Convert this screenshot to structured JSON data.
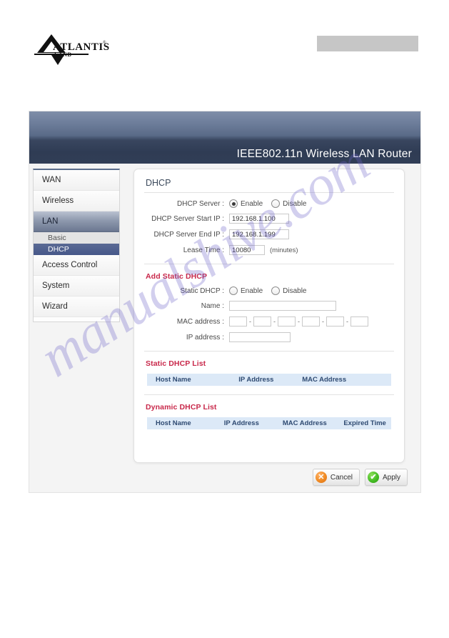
{
  "brand": {
    "logo_text": "ATLANTIS",
    "logo_subtext": "LAND",
    "logo_tm": "®",
    "logo_icon": "atlantis-triangle-logo"
  },
  "watermark": {
    "text": "manualshive.com"
  },
  "banner": {
    "title": "IEEE802.11n  Wireless LAN Router"
  },
  "sidebar": {
    "items": [
      {
        "label": "WAN",
        "type": "main",
        "active": false
      },
      {
        "label": "Wireless",
        "type": "main",
        "active": false
      },
      {
        "label": "LAN",
        "type": "main",
        "active": true
      },
      {
        "label": "Basic",
        "type": "sub",
        "active": false
      },
      {
        "label": "DHCP",
        "type": "sub",
        "active": true
      },
      {
        "label": "Access Control",
        "type": "main",
        "active": false
      },
      {
        "label": "System",
        "type": "main",
        "active": false
      },
      {
        "label": "Wizard",
        "type": "main",
        "active": false
      }
    ]
  },
  "panel": {
    "title": "DHCP",
    "dhcp": {
      "server_label": "DHCP Server :",
      "enable_label": "Enable",
      "disable_label": "Disable",
      "server_selected": "Enable",
      "start_ip_label": "DHCP Server Start IP :",
      "start_ip_value": "192.168.1.100",
      "end_ip_label": "DHCP Server End IP :",
      "end_ip_value": "192.168.1.199",
      "lease_label": "Lease Time :",
      "lease_value": "10080",
      "lease_unit": "(minutes)"
    },
    "add_static": {
      "section_title": "Add Static DHCP",
      "static_label": "Static DHCP :",
      "enable_label": "Enable",
      "disable_label": "Disable",
      "static_selected": "",
      "name_label": "Name :",
      "name_value": "",
      "mac_label": "MAC address :",
      "mac_segments": [
        "",
        "",
        "",
        "",
        "",
        ""
      ],
      "mac_separator": "-",
      "ip_label": "IP address :",
      "ip_value": ""
    },
    "static_list": {
      "section_title": "Static DHCP List",
      "columns": [
        "Host Name",
        "IP Address",
        "MAC Address",
        ""
      ],
      "rows": []
    },
    "dynamic_list": {
      "section_title": "Dynamic DHCP List",
      "columns": [
        "Host Name",
        "IP Address",
        "MAC Address",
        "Expired Time"
      ],
      "rows": []
    }
  },
  "actions": {
    "cancel_label": "Cancel",
    "cancel_icon": "circle-x-icon",
    "apply_label": "Apply",
    "apply_icon": "circle-check-icon"
  },
  "colors": {
    "section_heading": "#c8284a",
    "banner_dark": "#2f3c54",
    "banner_light": "#7f8ea8",
    "table_header_bg": "#dce9f7",
    "table_header_text": "#2e4a72",
    "cancel_orange": "#f08a22",
    "apply_green": "#45bd25",
    "sidebar_active_blue": "#47588a",
    "watermark_purple": "#6d63c8"
  }
}
